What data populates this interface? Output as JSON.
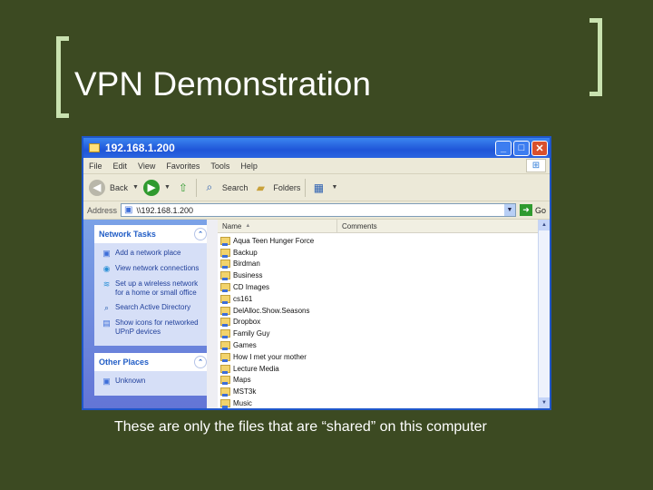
{
  "slide": {
    "title": "VPN Demonstration",
    "caption": "These are only the files that are “shared” on this computer"
  },
  "window": {
    "title": "192.168.1.200",
    "menu": [
      "File",
      "Edit",
      "View",
      "Favorites",
      "Tools",
      "Help"
    ],
    "toolbar": {
      "back_label": "Back",
      "search_label": "Search",
      "folders_label": "Folders"
    },
    "address": {
      "label": "Address",
      "value": "\\\\192.168.1.200",
      "go_label": "Go"
    },
    "network_tasks": {
      "title": "Network Tasks",
      "items": [
        "Add a network place",
        "View network connections",
        "Set up a wireless network for a home or small office",
        "Search Active Directory",
        "Show icons for networked UPnP devices"
      ]
    },
    "other_places": {
      "title": "Other Places",
      "items": [
        "Unknown"
      ]
    },
    "columns": {
      "name": "Name",
      "comments": "Comments"
    },
    "files": [
      "Aqua Teen Hunger Force",
      "Backup",
      "Birdman",
      "Business",
      "CD Images",
      "cs161",
      "DelAlloc.Show.Seasons",
      "Dropbox",
      "Family Guy",
      "Games",
      "How I met your mother",
      "Lecture Media",
      "Maps",
      "MST3k",
      "Music"
    ]
  }
}
